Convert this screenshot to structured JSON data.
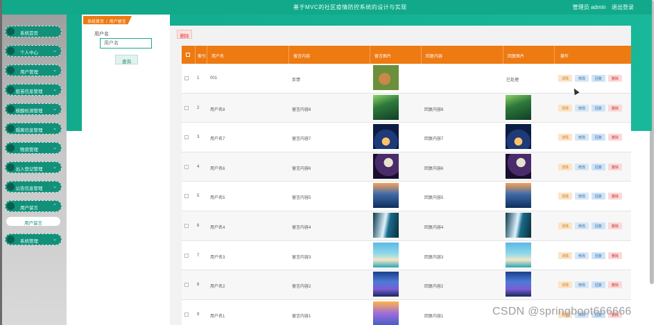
{
  "header": {
    "title": "基于MVC的社区疫情防控系统的设计与实现",
    "user_label": "管理员 admin",
    "logout_label": "退出登录"
  },
  "sidebar": {
    "items": [
      {
        "label": "系统首页"
      },
      {
        "label": "个人中心"
      },
      {
        "label": "用户管理"
      },
      {
        "label": "疫苗信息管理"
      },
      {
        "label": "核酸检测管理"
      },
      {
        "label": "隔离信息管理"
      },
      {
        "label": "物资管理"
      },
      {
        "label": "出入登记管理"
      },
      {
        "label": "公告信息管理"
      },
      {
        "label": "用户留言"
      },
      {
        "label": "系统管理"
      }
    ],
    "sub_item": "用户留言"
  },
  "breadcrumb": {
    "home": "系统首页",
    "current": "用户留言"
  },
  "search": {
    "label": "用户名",
    "placeholder": "用户名",
    "button": "查询"
  },
  "toolbar": {
    "delete_label": "删除"
  },
  "table": {
    "headers": [
      "",
      "索引",
      "用户名",
      "留言内容",
      "留言图片",
      "回复内容",
      "回复图片",
      "操作"
    ],
    "rows": [
      {
        "index": "1",
        "user": "001",
        "content": "反馈",
        "reply": "",
        "img": "img-rabbit",
        "reply_img": "",
        "reply_text": "已处理"
      },
      {
        "index": "2",
        "user": "用户名8",
        "content": "留言内容8",
        "reply": "回复内容8",
        "img": "img-forest",
        "reply_img": "img-forest",
        "reply_text": ""
      },
      {
        "index": "3",
        "user": "用户名7",
        "content": "留言内容7",
        "reply": "回复内容7",
        "img": "img-tent",
        "reply_img": "img-tent",
        "reply_text": ""
      },
      {
        "index": "4",
        "user": "用户名6",
        "content": "留言内容6",
        "reply": "回复内容6",
        "img": "img-moon",
        "reply_img": "img-moon",
        "reply_text": ""
      },
      {
        "index": "5",
        "user": "用户名5",
        "content": "留言内容5",
        "reply": "回复内容5",
        "img": "img-lake",
        "reply_img": "img-lake",
        "reply_text": ""
      },
      {
        "index": "6",
        "user": "用户名4",
        "content": "留言内容4",
        "reply": "回复内容4",
        "img": "img-fall",
        "reply_img": "img-fall",
        "reply_text": ""
      },
      {
        "index": "7",
        "user": "用户名3",
        "content": "留言内容3",
        "reply": "回复内容3",
        "img": "img-beach",
        "reply_img": "img-beach",
        "reply_text": ""
      },
      {
        "index": "8",
        "user": "用户名2",
        "content": "留言内容2",
        "reply": "回复内容2",
        "img": "img-mount",
        "reply_img": "img-mount",
        "reply_text": ""
      },
      {
        "index": "9",
        "user": "用户名1",
        "content": "留言内容1",
        "reply": "回复内容1",
        "img": "img-last",
        "reply_img": "",
        "reply_text": ""
      }
    ],
    "actions": {
      "detail": "详情",
      "edit": "修改",
      "review": "回复",
      "delete": "删除"
    }
  },
  "watermark": "CSDN @springboot666666",
  "colors": {
    "primary": "#12a98b",
    "accent": "#ee7a12",
    "danger": "#d33333"
  }
}
